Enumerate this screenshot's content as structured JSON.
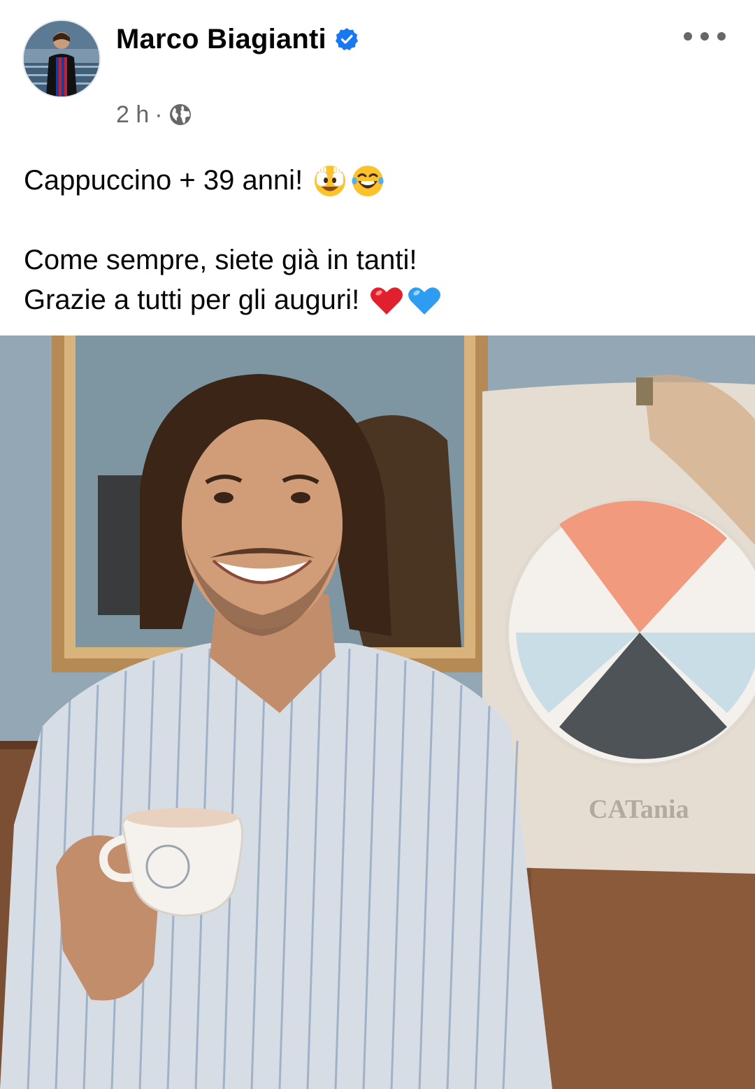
{
  "post": {
    "author": "Marco Biagianti",
    "verified_icon": "verified-badge-icon",
    "time": "2 h",
    "separator": "·",
    "audience_icon": "globe-icon",
    "more_icon": "more-options-icon",
    "text": {
      "line1": "Cappuccino + 39 anni!",
      "line1_emojis": [
        "face-hands-over-eyes-emoji",
        "tears-of-joy-emoji"
      ],
      "line2": "Come sempre, siete già in tanti!",
      "line3": "Grazie a tutti per gli auguri!",
      "line3_emojis": [
        "red-heart-emoji",
        "blue-heart-emoji"
      ]
    },
    "photo": {
      "poster_text": "CATania"
    }
  },
  "colors": {
    "verified": "#1877f2",
    "secondary_text": "#65676b",
    "primary_text": "#050505"
  }
}
